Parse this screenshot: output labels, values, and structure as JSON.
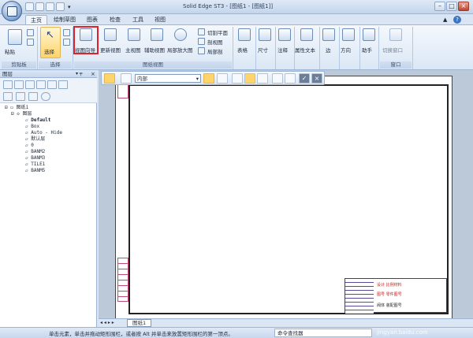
{
  "title": "Solid Edge ST3 - [图纸1 - [图纸1]]",
  "tabs": [
    "主页",
    "绘制草图",
    "图表",
    "检查",
    "工具",
    "视图"
  ],
  "active_tab": "主页",
  "ribbon": {
    "clipboard": {
      "paste": "粘贴",
      "label": "剪贴板"
    },
    "select": {
      "select": "选择",
      "label": "选择"
    },
    "views": {
      "view_wizard": "视图向导",
      "update_views": "更新视图",
      "principal_view": "主视图",
      "auxiliary_view": "辅助视图",
      "detail_view": "局部放大图",
      "section_plane": "切割平面",
      "section_view": "剖视图",
      "broken_out": "局部剖",
      "label": "图纸视图"
    },
    "table": "表格",
    "dimension": "尺寸",
    "annotation": "注释",
    "property_text": "属性文本",
    "edge": "边",
    "direction": "方向",
    "assistant": "助手",
    "switch_window": "切换窗口",
    "window_label": "窗口"
  },
  "panel": {
    "title": "图层",
    "tree": [
      "图纸1",
      "图层",
      "Default",
      "Box",
      "Auto - Hide",
      "默认层",
      "0",
      "BANM2",
      "BANM3",
      "TILE1",
      "BANM5"
    ]
  },
  "context_toolbar": {
    "view_select": "内部"
  },
  "sheet_tab": "图纸1",
  "title_block": {
    "line1": "设计  比例材料",
    "line2": "图号 零件图号",
    "line3": "阀体  装配图号"
  },
  "status": {
    "hint": "单击元素，单击并拖动矩形围栏，或者按 Alt 并单击来放置矩形围栏的第一顶点。",
    "command_finder": "命令查找器",
    "watermark": "jingyan.baidu.com"
  },
  "colors": {
    "highlight_box": "#e0212c",
    "ribbon_bg": "#dbe7f5",
    "title_red": "#d02020"
  }
}
